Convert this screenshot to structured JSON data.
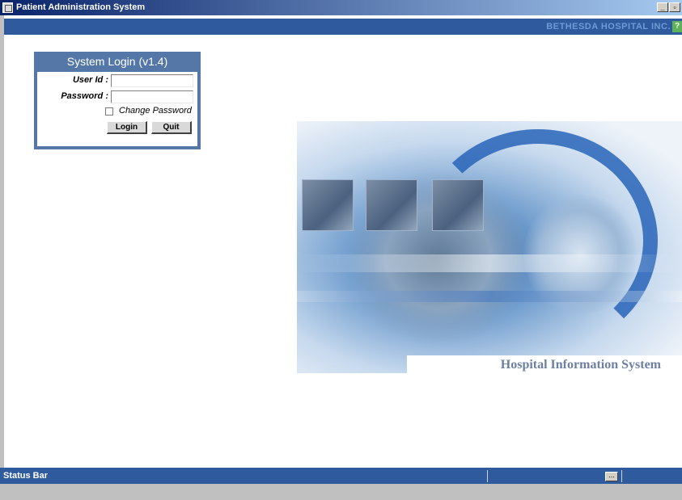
{
  "window": {
    "title": "Patient Administration System"
  },
  "banner": {
    "company": "BETHESDA HOSPITAL INC.",
    "help_icon": "help-icon"
  },
  "login": {
    "title": "System Login (v1.4)",
    "user_label": "User Id :",
    "user_value": "",
    "password_label": "Password :",
    "password_value": "",
    "change_password_label": "Change Password",
    "change_password_checked": false,
    "login_button": "Login",
    "quit_button": "Quit"
  },
  "hero": {
    "slogan": "Hospital Information System"
  },
  "status_bar": {
    "label": "Status Bar",
    "button": "..."
  },
  "colors": {
    "banner": "#2f5a9e",
    "login_header": "#5577a8",
    "slogan": "#6d7fa3"
  }
}
